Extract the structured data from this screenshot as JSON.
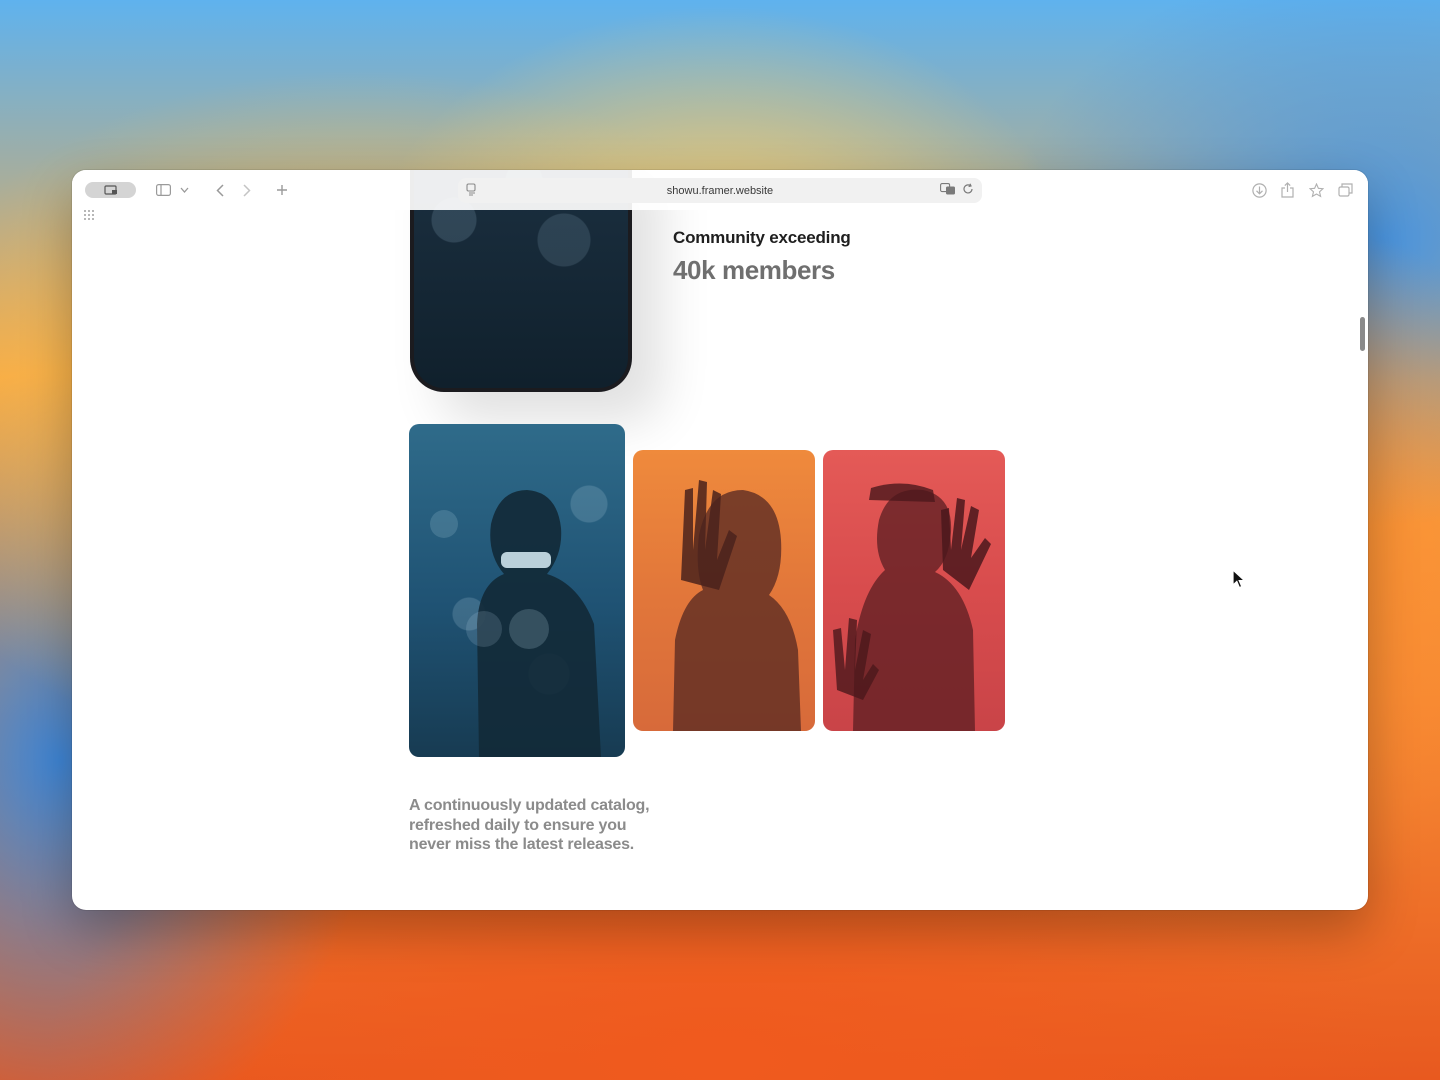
{
  "browser": {
    "url": "showu.framer.website",
    "icons": [
      "tab-overview-icon",
      "sidebar-icon",
      "chevron-down-icon",
      "back-icon",
      "forward-icon",
      "new-tab-icon",
      "page-menu-icon",
      "translate-icon",
      "reload-icon",
      "download-icon",
      "share-icon",
      "bookmark-icon",
      "tabs-icon",
      "grid-icon"
    ]
  },
  "page": {
    "community_label": "Community exceeding",
    "community_value": "40k members",
    "caption": "A continuously updated catalog, refreshed daily to ensure you never miss the latest releases."
  },
  "colors": {
    "window_bg": "#ffffff",
    "heading_dark": "#1f1f1f",
    "heading_gray": "#6f6f6f",
    "caption_gray": "#8b8b8b"
  }
}
